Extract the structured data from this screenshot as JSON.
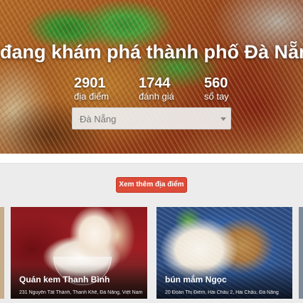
{
  "hero": {
    "title": "đang khám phá thành phố Đà Nẵng",
    "stats": [
      {
        "value": "2901",
        "label": "địa điểm"
      },
      {
        "value": "1744",
        "label": "đánh giá"
      },
      {
        "value": "560",
        "label": "sổ tay"
      }
    ],
    "city_select": {
      "selected": "Đà Nẵng"
    }
  },
  "actions": {
    "see_more_label": "Xem thêm địa điểm"
  },
  "places": [
    {
      "name": "Quán kem Thanh Bình",
      "address": "231 Nguyễn Tất Thành, Thanh Khê, Đà Nẵng, Việt Nam"
    },
    {
      "name": "bún mắm Ngọc",
      "address": "20 Đoàn Thị Điểm, Hải Châu 2, Hải Châu, Đà Nẵng"
    }
  ],
  "colors": {
    "accent": "#dd4b39"
  }
}
